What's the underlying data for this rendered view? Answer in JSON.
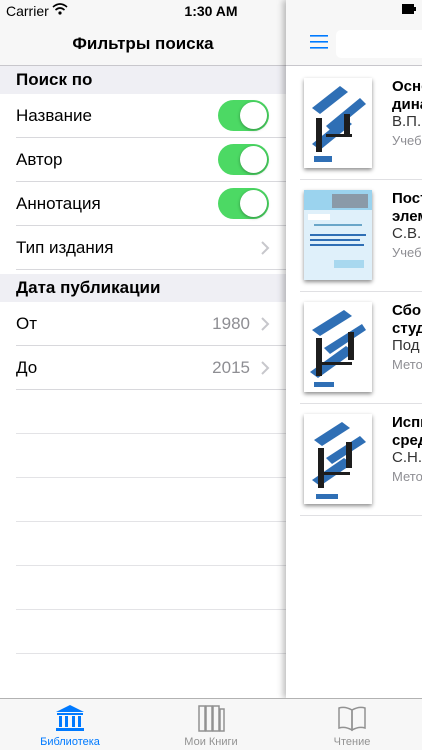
{
  "status_bar": {
    "carrier": "Carrier",
    "time": "1:30 AM"
  },
  "filters": {
    "title": "Фильтры поиска",
    "search_in": {
      "header": "Поиск по",
      "items": [
        {
          "label": "Название",
          "enabled": true
        },
        {
          "label": "Автор",
          "enabled": true
        },
        {
          "label": "Аннотация",
          "enabled": true
        },
        {
          "label": "Тип издания"
        }
      ]
    },
    "pub_date": {
      "header": "Дата публикации",
      "from_label": "От",
      "from_value": "1980",
      "to_label": "До",
      "to_value": "2015"
    }
  },
  "books": [
    {
      "title_line1": "Осно",
      "title_line2": "дина",
      "author": "В.П.",
      "type": "Учеб"
    },
    {
      "title_line1": "Пост",
      "title_line2": "элем",
      "author": "С.В.",
      "type": "Учеб"
    },
    {
      "title_line1": "Сбор",
      "title_line2": "студ",
      "author": "Под",
      "type": "Мето"
    },
    {
      "title_line1": "Испы",
      "title_line2": "сред",
      "author": "С.Н.",
      "type": "Мето"
    }
  ],
  "tabs": [
    {
      "label": "Библиотека",
      "icon": "library-icon",
      "active": true
    },
    {
      "label": "Мои Книги",
      "icon": "books-icon",
      "active": false
    },
    {
      "label": "Чтение",
      "icon": "open-book-icon",
      "active": false
    }
  ],
  "colors": {
    "accent": "#007aff",
    "toggle_on": "#4cd964",
    "cover_blue": "#2f6fb5"
  }
}
